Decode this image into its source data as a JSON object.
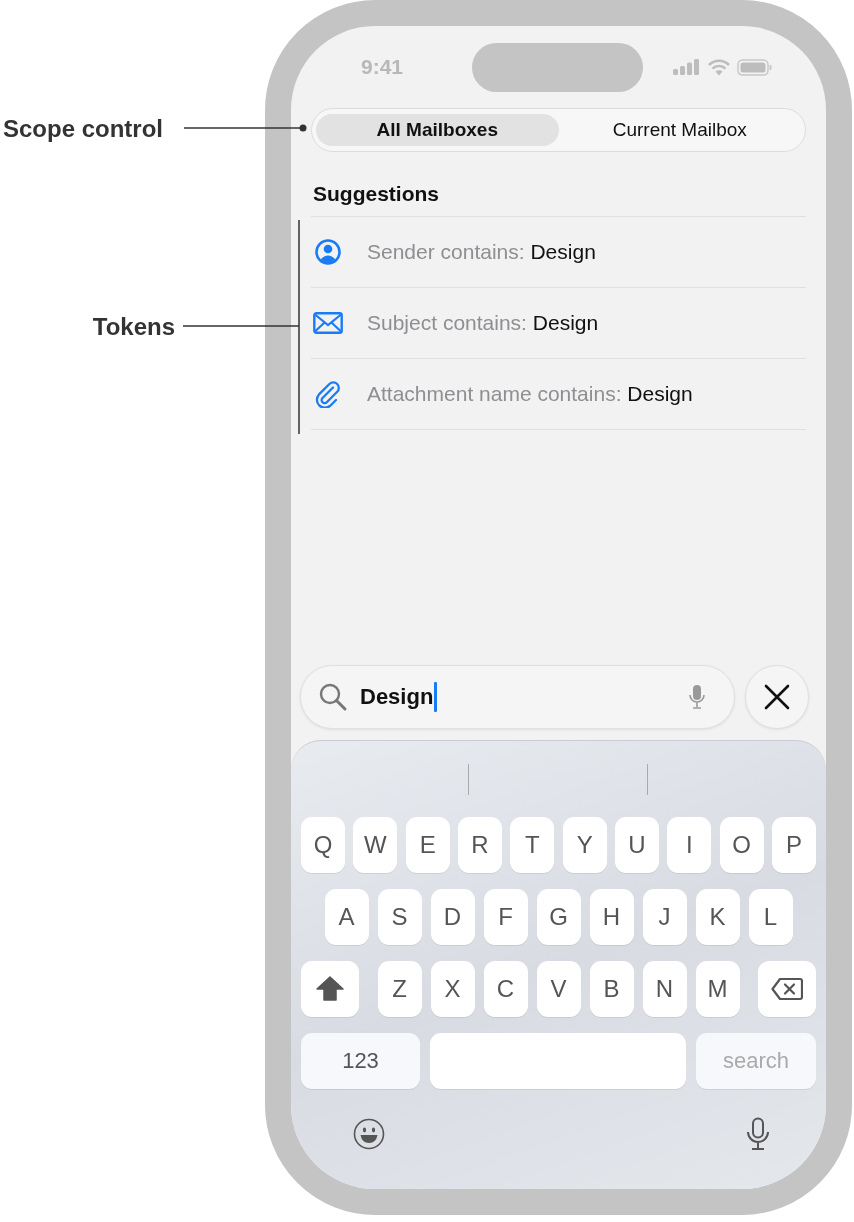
{
  "annotations": [
    {
      "label": "Scope control"
    },
    {
      "label": "Tokens"
    }
  ],
  "status_bar": {
    "time": "9:41"
  },
  "scope_control": {
    "segments": [
      {
        "label": "All Mailboxes",
        "selected": true
      },
      {
        "label": "Current Mailbox",
        "selected": false
      }
    ]
  },
  "suggestions": {
    "title": "Suggestions",
    "tokens": [
      {
        "kind": "sender",
        "field": "Sender contains:",
        "value": "Design"
      },
      {
        "kind": "subject",
        "field": "Subject contains:",
        "value": "Design"
      },
      {
        "kind": "attachment",
        "field": "Attachment name contains:",
        "value": "Design"
      }
    ]
  },
  "search_field": {
    "value": "Design"
  },
  "keyboard": {
    "rows": [
      [
        "Q",
        "W",
        "E",
        "R",
        "T",
        "Y",
        "U",
        "I",
        "O",
        "P"
      ],
      [
        "A",
        "S",
        "D",
        "F",
        "G",
        "H",
        "J",
        "K",
        "L"
      ],
      [
        "Z",
        "X",
        "C",
        "V",
        "B",
        "N",
        "M"
      ]
    ],
    "number_key": "123",
    "action_key": "search"
  }
}
